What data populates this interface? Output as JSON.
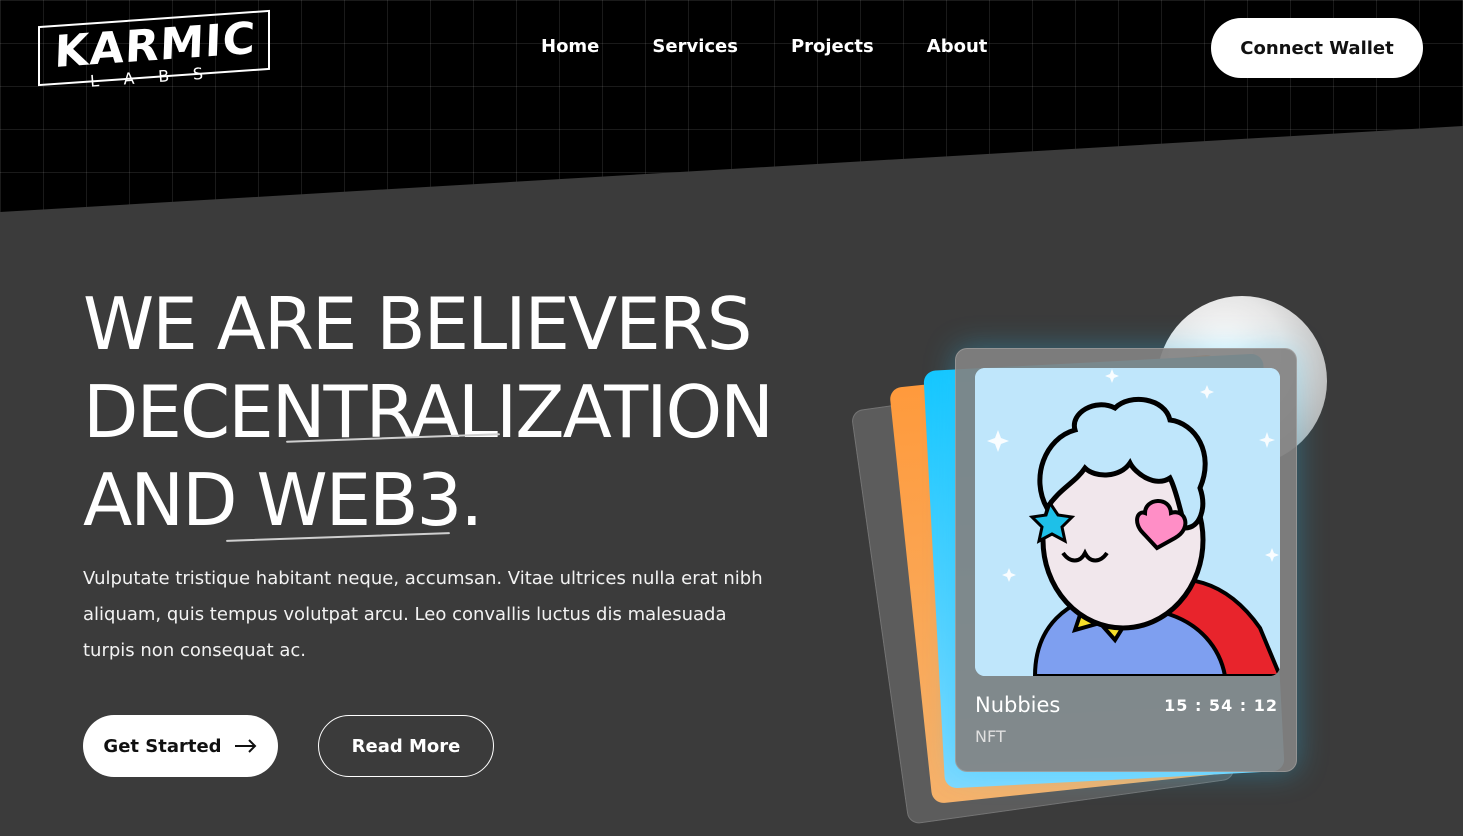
{
  "header": {
    "logo": {
      "main": "KARMIC",
      "sub": "LABS"
    },
    "nav": [
      "Home",
      "Services",
      "Projects",
      "About"
    ],
    "connect_label": "Connect Wallet"
  },
  "hero": {
    "headline": [
      "WE ARE BELIEVERS",
      "DECENTRALIZATION",
      "AND WEB3."
    ],
    "description": "Vulputate tristique habitant neque, accumsan. Vitae ultrices nulla erat nibh aliquam, quis tempus volutpat arcu. Leo convallis luctus dis malesuada turpis non consequat ac.",
    "primary_cta": "Get Started",
    "secondary_cta": "Read More"
  },
  "nft_card": {
    "name": "Nubbies",
    "type": "NFT",
    "timer": "15 : 54 : 12"
  }
}
